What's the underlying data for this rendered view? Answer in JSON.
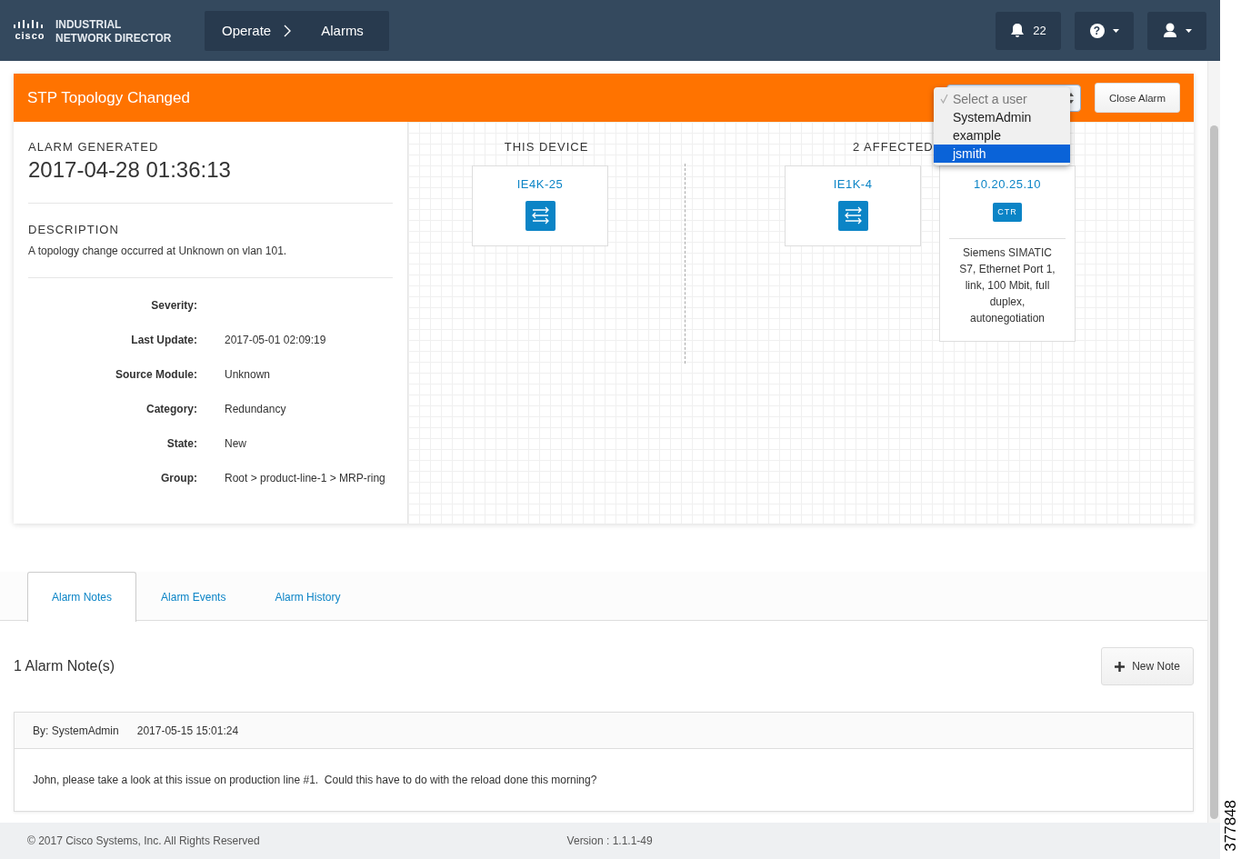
{
  "header": {
    "logo_text": "cisco",
    "product_name": [
      "INDUSTRIAL",
      "NETWORK DIRECTOR"
    ],
    "breadcrumb": [
      "Operate",
      "Alarms"
    ],
    "notification_count": "22",
    "help_symbol": "?"
  },
  "alarm": {
    "title": "STP Topology Changed",
    "user_select": {
      "options": [
        {
          "label": "Select a user",
          "checked": true,
          "highlighted": false
        },
        {
          "label": "SystemAdmin",
          "checked": false,
          "highlighted": false
        },
        {
          "label": "example",
          "checked": false,
          "highlighted": false
        },
        {
          "label": "jsmith",
          "checked": false,
          "highlighted": true
        }
      ]
    },
    "close_button": "Close Alarm",
    "generated_label": "ALARM GENERATED",
    "generated_time": "2017-04-28 01:36:13",
    "description_label": "DESCRIPTION",
    "description": "A topology change occurred at Unknown on vlan 101.",
    "details": [
      {
        "label": "Severity:"
      },
      {
        "label": "Last Update:",
        "value": "2017-05-01 02:09:19"
      },
      {
        "label": "Source Module:",
        "value": "Unknown"
      },
      {
        "label": "Category:",
        "value": "Redundancy"
      },
      {
        "label": "State:",
        "value": "New"
      },
      {
        "label": "Group:",
        "value": "Root > product-line-1 > MRP-ring"
      }
    ]
  },
  "devices": {
    "this_device_heading": "THIS DEVICE",
    "this_device": [
      {
        "name": "IE4K-25",
        "kind": "switch"
      }
    ],
    "affected_heading": "2 AFFECTED",
    "affected": [
      {
        "name": "IE1K-4",
        "kind": "switch"
      },
      {
        "name": "10.20.25.10",
        "kind": "controller",
        "icon_label": "CTR",
        "description": "Siemens SIMATIC S7, Ethernet Port 1, link, 100 Mbit, full duplex, autonegotiation"
      }
    ]
  },
  "tabs": [
    {
      "label": "Alarm Notes",
      "selected": true
    },
    {
      "label": "Alarm Events",
      "selected": false
    },
    {
      "label": "Alarm History",
      "selected": false
    }
  ],
  "notes_count": "1 Alarm Note(s)",
  "new_note_button": "New Note",
  "notes": [
    {
      "author": "By: SystemAdmin",
      "time": "2017-05-15 15:01:24",
      "text": "John, please take a look at this issue on production line #1.  Could this have to do with the reload done this morning?"
    }
  ],
  "footer": {
    "copyright": "© 2017 Cisco Systems, Inc. All Rights Reserved",
    "version": "Version : 1.1.1-49"
  },
  "figure_id": "377848"
}
